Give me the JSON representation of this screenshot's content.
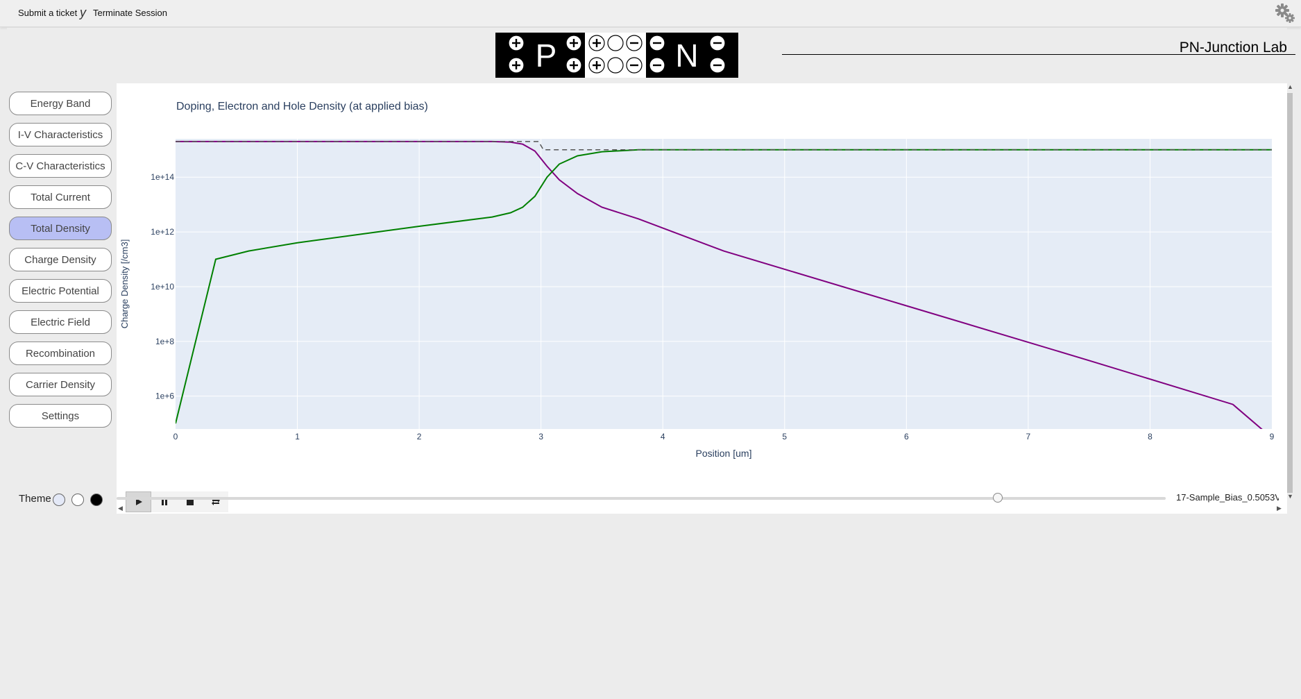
{
  "topbar": {
    "submit_ticket": "Submit a ticket",
    "separator": "y",
    "terminate": "Terminate Session"
  },
  "header": {
    "lab_title": "PN-Junction Lab",
    "logo_p": "P",
    "logo_n": "N"
  },
  "sidebar": {
    "items": [
      {
        "label": "Energy Band"
      },
      {
        "label": "I-V Characteristics"
      },
      {
        "label": "C-V Characteristics"
      },
      {
        "label": "Total Current"
      },
      {
        "label": "Total Density",
        "active": true
      },
      {
        "label": "Charge Density"
      },
      {
        "label": "Electric Potential"
      },
      {
        "label": "Electric Field"
      },
      {
        "label": "Recombination"
      },
      {
        "label": "Carrier Density"
      },
      {
        "label": "Settings"
      }
    ],
    "theme_label": "Theme",
    "theme_swatches": [
      "#e4e9f7",
      "#ffffff",
      "#000000"
    ]
  },
  "plot": {
    "title": "Doping, Electron and Hole Density (at applied bias)"
  },
  "animation": {
    "play_icon": "play-icon",
    "pause_icon": "pause-icon",
    "stop_icon": "stop-icon",
    "loop_icon": "loop-icon",
    "slider_label": "17-Sample_Bias_0.5053V",
    "slider_value_fraction": 0.84
  },
  "colors": {
    "plot_bg": "#e5ecf6",
    "axis_text": "#2a3f5f",
    "hole": "#800080",
    "electron": "#008000",
    "doping": "#555555",
    "active_nav": "#b8bff4"
  },
  "chart_data": {
    "type": "line",
    "title": "Doping, Electron and Hole Density (at applied bias)",
    "xlabel": "Position [um]",
    "ylabel": "Charge Density [/cm3]",
    "xlim": [
      0,
      9
    ],
    "ylog": true,
    "ylim_log10": [
      4.8,
      15.4
    ],
    "x_ticks": [
      "0",
      "1",
      "2",
      "3",
      "4",
      "5",
      "6",
      "7",
      "8",
      "9"
    ],
    "y_ticks": [
      {
        "label": "1e+6",
        "value": 1000000.0
      },
      {
        "label": "1e+8",
        "value": 100000000.0
      },
      {
        "label": "1e+10",
        "value": 10000000000.0
      },
      {
        "label": "1e+12",
        "value": 1000000000000.0
      },
      {
        "label": "1e+14",
        "value": 100000000000000.0
      }
    ],
    "grid": true,
    "series": [
      {
        "color": "#800080",
        "dash": "solid",
        "x": [
          0,
          2.6,
          2.75,
          2.85,
          2.95,
          3.05,
          3.15,
          3.3,
          3.5,
          3.8,
          4.5,
          6,
          7.5,
          8.68,
          9
        ],
        "y": [
          2000000000000000.0,
          2000000000000000.0,
          1900000000000000.0,
          1600000000000000.0,
          900000000000000.0,
          250000000000000.0,
          80000000000000.0,
          25000000000000.0,
          8000000000000.0,
          3000000000000.0,
          200000000000.0,
          2000000000.0,
          20000000.0,
          500000.0,
          30000.0
        ]
      },
      {
        "color": "#008000",
        "dash": "solid",
        "x": [
          0,
          0.33,
          0.6,
          1,
          1.5,
          2,
          2.6,
          2.75,
          2.85,
          2.95,
          3.05,
          3.15,
          3.3,
          3.5,
          3.8,
          9
        ],
        "y": [
          100000.0,
          100000000000.0,
          200000000000.0,
          400000000000.0,
          800000000000.0,
          1600000000000.0,
          3500000000000.0,
          5000000000000.0,
          8000000000000.0,
          20000000000000.0,
          100000000000000.0,
          300000000000000.0,
          600000000000000.0,
          850000000000000.0,
          1000000000000000.0,
          1000000000000000.0
        ]
      },
      {
        "color": "#555555",
        "dash": "dash",
        "x": [
          0,
          2.98,
          3.02,
          9
        ],
        "y": [
          2000000000000000.0,
          2000000000000000.0,
          1000000000000000.0,
          1000000000000000.0
        ]
      }
    ]
  }
}
